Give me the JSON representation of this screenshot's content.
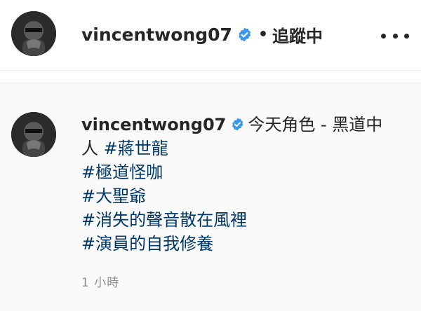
{
  "header": {
    "username": "vincentwong07",
    "verified_icon": "verified-badge-icon",
    "separator": "•",
    "follow_state": "追蹤中",
    "more_icon": "more-options-icon"
  },
  "caption": {
    "username": "vincentwong07",
    "text": "今天角色 - 黑道中人",
    "text_part1": "今天角色 - 黑道中",
    "text_part2": "人",
    "hashtags": [
      "#蔣世龍",
      "#極道怪咖",
      "#大聖爺",
      "#消失的聲音散在風裡",
      "#演員的自我修養"
    ],
    "time": "1 小時"
  },
  "colors": {
    "verified_blue": "#3897f0",
    "hashtag": "#00376b",
    "timestamp": "#8e8e8e",
    "panel_bg": "#fafafa"
  }
}
